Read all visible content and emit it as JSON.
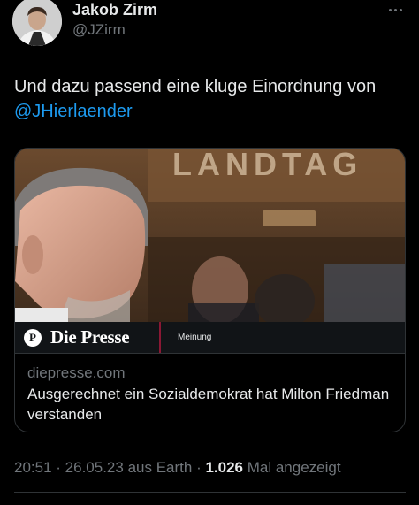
{
  "author": {
    "name": "Jakob Zirm",
    "handle": "@JZirm",
    "avatar_icon": "person-avatar"
  },
  "tweet": {
    "text_line1": "Und dazu passend eine kluge Einordnung von",
    "mention": "@JHierlaender"
  },
  "card": {
    "image_sign_text": "LANDTAG",
    "brand_logo_letter": "P",
    "brand_name": "Die Presse",
    "category": "Meinung",
    "domain": "diepresse.com",
    "title": "Ausgerechnet ein Sozialdemokrat hat Milton Friedman verstanden"
  },
  "meta": {
    "time": "20:51",
    "sep1": " · ",
    "date": "26.05.23",
    "source": " aus Earth",
    "sep2": " · ",
    "views_count": "1.026",
    "views_label": " Mal angezeigt"
  },
  "colors": {
    "background": "#000000",
    "text_primary": "#e7e9ea",
    "text_secondary": "#71767b",
    "link": "#1d9bf0",
    "border": "#2f3336",
    "presse_accent": "#8a1834"
  }
}
